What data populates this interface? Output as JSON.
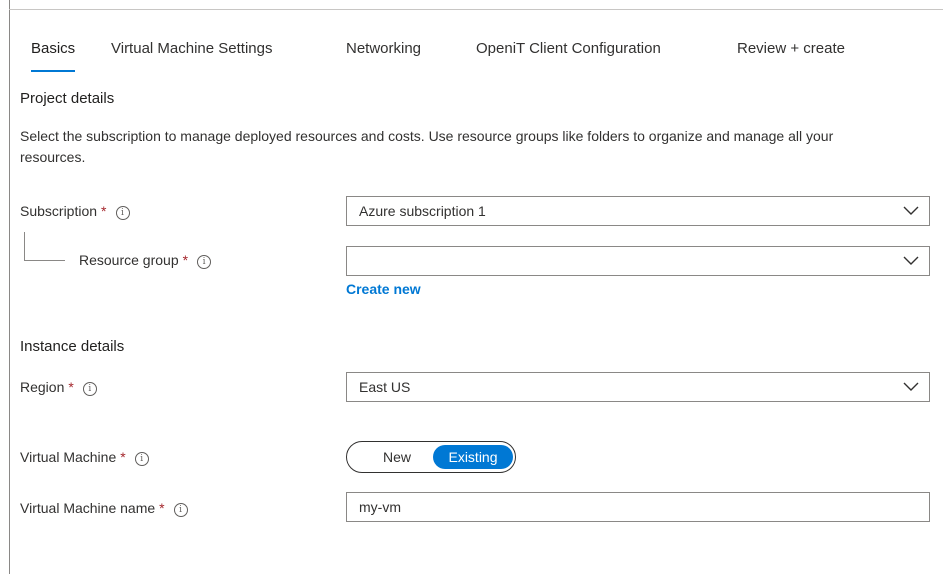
{
  "tabs": [
    {
      "label": "Basics",
      "active": true
    },
    {
      "label": "Virtual Machine Settings",
      "active": false
    },
    {
      "label": "Networking",
      "active": false
    },
    {
      "label": "OpeniT Client Configuration",
      "active": false
    },
    {
      "label": "Review + create",
      "active": false
    }
  ],
  "project": {
    "heading": "Project details",
    "description": "Select the subscription to manage deployed resources and costs. Use resource groups like folders to organize and manage all your resources."
  },
  "fields": {
    "subscription": {
      "label": "Subscription",
      "required_mark": "*",
      "value": "Azure subscription 1"
    },
    "resource_group": {
      "label": "Resource group",
      "required_mark": "*",
      "value": "",
      "create_new": "Create new"
    },
    "region": {
      "label": "Region",
      "required_mark": "*",
      "value": "East US"
    },
    "virtual_machine": {
      "label": "Virtual Machine",
      "required_mark": "*",
      "options": [
        "New",
        "Existing"
      ],
      "selected": "Existing"
    },
    "vm_name": {
      "label": "Virtual Machine name",
      "required_mark": "*",
      "value": "my-vm"
    }
  },
  "instance": {
    "heading": "Instance details"
  },
  "icons": {
    "info": "info-icon",
    "dropdown": "chevron-down-icon"
  },
  "colors": {
    "accent": "#0078d4",
    "required": "#a4262c"
  }
}
